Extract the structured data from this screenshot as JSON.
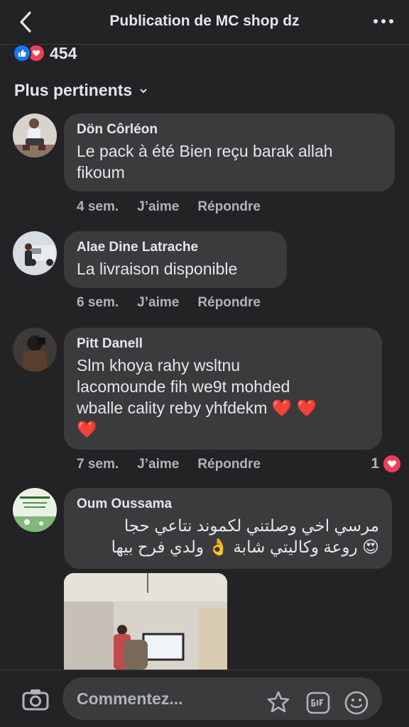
{
  "header": {
    "title": "Publication de MC shop dz"
  },
  "reactions": {
    "count": "454"
  },
  "sort": {
    "label": "Plus pertinents"
  },
  "actions": {
    "like": "J’aime",
    "reply": "Répondre"
  },
  "comments": [
    {
      "author": "Dön Côrléon",
      "lines": [
        "Le pack à été Bien reçu barak allah",
        "fikoum"
      ],
      "time": "4 sem."
    },
    {
      "author": "Alae Dine Latrache",
      "lines": [
        "La livraison disponible"
      ],
      "time": "6 sem."
    },
    {
      "author": "Pitt Danell",
      "lines": [
        "Slm khoya rahy wsltnu",
        "lacomounde fih we9t mohded",
        "wballe cality reby yhfdekm ❤️ ❤️",
        "❤️"
      ],
      "time": "7 sem.",
      "reaction_count": "1"
    },
    {
      "author": "Oum Oussama",
      "lines": [
        "مرسي اخي وصلتني لكموند نتاعي حجا",
        "😍 روعة وكاليتي شابة 👌 ولدي فرح بيها"
      ]
    }
  ],
  "composer": {
    "placeholder": "Commentez..."
  },
  "colors": {
    "background": "#232325",
    "bubble": "#3a3b3c",
    "like_blue": "#1877f2",
    "love_red": "#f33e58"
  }
}
